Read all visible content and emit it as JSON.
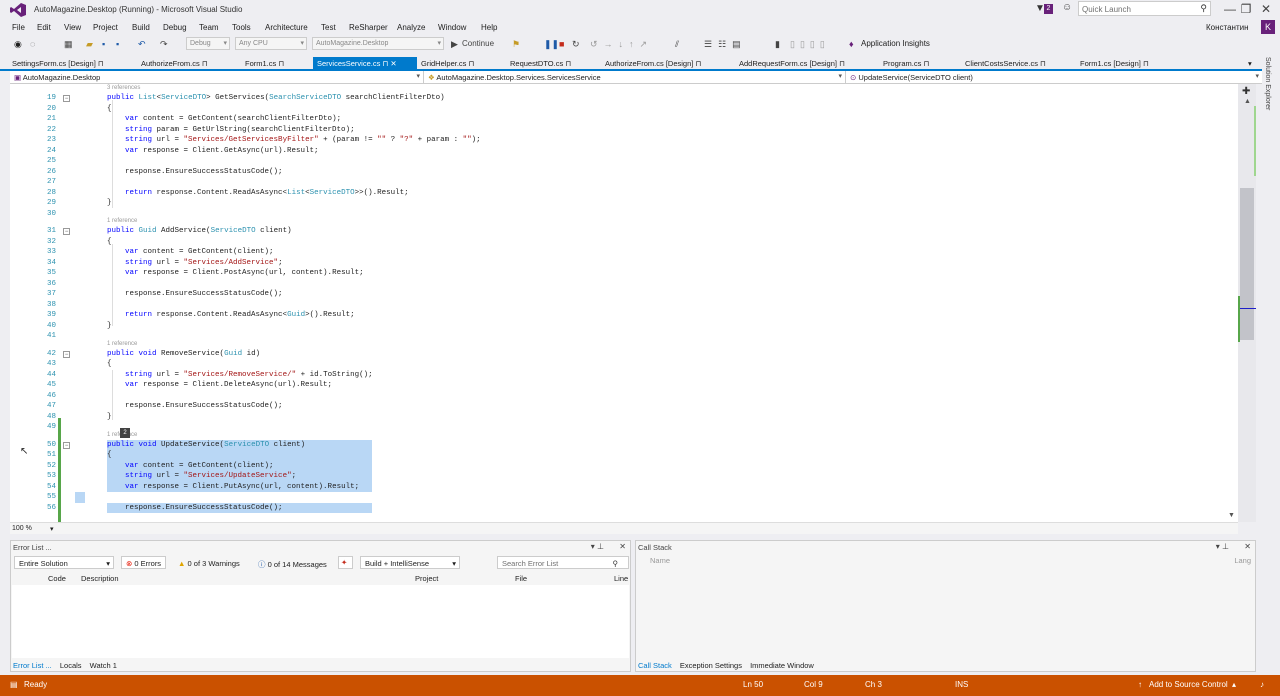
{
  "window": {
    "title": "AutoMagazine.Desktop (Running) - Microsoft Visual Studio",
    "quick_launch_placeholder": "Quick Launch",
    "notification_count": "2",
    "user": "Константин",
    "user_initial": "K",
    "controls": [
      "—",
      "❐",
      "✕"
    ]
  },
  "menu": [
    "File",
    "Edit",
    "View",
    "Project",
    "Build",
    "Debug",
    "Team",
    "Tools",
    "Architecture",
    "Test",
    "ReSharper",
    "Analyze",
    "Window",
    "Help"
  ],
  "toolbar": {
    "config": "Debug",
    "platform": "Any CPU",
    "startup": "AutoMagazine.Desktop",
    "continue": "Continue",
    "app_insights": "Application Insights"
  },
  "tabs": [
    {
      "label": "SettingsForm.cs [Design]",
      "active": false
    },
    {
      "label": "AuthorizeFrom.cs",
      "active": false
    },
    {
      "label": "Form1.cs",
      "active": false
    },
    {
      "label": "ServicesService.cs",
      "active": true
    },
    {
      "label": "GridHelper.cs",
      "active": false
    },
    {
      "label": "RequestDTO.cs",
      "active": false
    },
    {
      "label": "AuthorizeFrom.cs [Design]",
      "active": false
    },
    {
      "label": "AddRequestForm.cs [Design]",
      "active": false
    },
    {
      "label": "Program.cs",
      "active": false
    },
    {
      "label": "ClientCostsService.cs",
      "active": false
    },
    {
      "label": "Form1.cs [Design]",
      "active": false
    }
  ],
  "nav": {
    "project": "AutoMagazine.Desktop",
    "type": "AutoMagazine.Desktop.Services.ServicesService",
    "member": "UpdateService(ServiceDTO client)"
  },
  "code": [
    {
      "ref": "3 references"
    },
    {
      "n": "19",
      "t": "public List<ServiceDTO> GetServices(SearchServiceDTO searchClientFilterDto)"
    },
    {
      "n": "20",
      "t": "{"
    },
    {
      "n": "21",
      "t": "    var content = GetContent(searchClientFilterDto);"
    },
    {
      "n": "22",
      "t": "    string param = GetUrlString(searchClientFilterDto);"
    },
    {
      "n": "23",
      "t": "    string url = \"Services/GetServicesByFilter\" + (param != \"\" ? \"?\" + param : \"\");"
    },
    {
      "n": "24",
      "t": "    var response = Client.GetAsync(url).Result;"
    },
    {
      "n": "25",
      "t": ""
    },
    {
      "n": "26",
      "t": "    response.EnsureSuccessStatusCode();"
    },
    {
      "n": "27",
      "t": ""
    },
    {
      "n": "28",
      "t": "    return response.Content.ReadAsAsync<List<ServiceDTO>>().Result;"
    },
    {
      "n": "29",
      "t": "}"
    },
    {
      "n": "30",
      "t": ""
    },
    {
      "ref": "1 reference"
    },
    {
      "n": "31",
      "t": "public Guid AddService(ServiceDTO client)"
    },
    {
      "n": "32",
      "t": "{"
    },
    {
      "n": "33",
      "t": "    var content = GetContent(client);"
    },
    {
      "n": "34",
      "t": "    string url = \"Services/AddService\";"
    },
    {
      "n": "35",
      "t": "    var response = Client.PostAsync(url, content).Result;"
    },
    {
      "n": "36",
      "t": ""
    },
    {
      "n": "37",
      "t": "    response.EnsureSuccessStatusCode();"
    },
    {
      "n": "38",
      "t": ""
    },
    {
      "n": "39",
      "t": "    return response.Content.ReadAsAsync<Guid>().Result;"
    },
    {
      "n": "40",
      "t": "}"
    },
    {
      "n": "41",
      "t": ""
    },
    {
      "ref": "1 reference"
    },
    {
      "n": "42",
      "t": "public void RemoveService(Guid id)"
    },
    {
      "n": "43",
      "t": "{"
    },
    {
      "n": "44",
      "t": "    string url = \"Services/RemoveService/\" + id.ToString();"
    },
    {
      "n": "45",
      "t": "    var response = Client.DeleteAsync(url).Result;"
    },
    {
      "n": "46",
      "t": ""
    },
    {
      "n": "47",
      "t": "    response.EnsureSuccessStatusCode();"
    },
    {
      "n": "48",
      "t": "}"
    },
    {
      "n": "49",
      "t": ""
    },
    {
      "ref": "1 reference"
    },
    {
      "n": "50",
      "t": "public void UpdateService(ServiceDTO client)",
      "sel": true
    },
    {
      "n": "51",
      "t": "{",
      "sel": true
    },
    {
      "n": "52",
      "t": "    var content = GetContent(client);",
      "sel": true
    },
    {
      "n": "53",
      "t": "    string url = \"Services/UpdateService\";",
      "sel": true
    },
    {
      "n": "54",
      "t": "    var response = Client.PutAsync(url, content).Result;",
      "sel": true
    },
    {
      "n": "55",
      "t": "",
      "sel": true
    },
    {
      "n": "56",
      "t": "    response.EnsureSuccessStatusCode();",
      "sel": true
    }
  ],
  "quick_action_badge": "2",
  "zoom": "100 %",
  "error_list": {
    "title": "Error List ...",
    "scope": "Entire Solution",
    "errors": "0 Errors",
    "warnings": "0 of 3 Warnings",
    "messages": "0 of 14 Messages",
    "build": "Build + IntelliSense",
    "search_placeholder": "Search Error List",
    "columns": [
      "Code",
      "Description",
      "Project",
      "File",
      "Line"
    ],
    "tabs": [
      "Error List ...",
      "Locals",
      "Watch 1"
    ]
  },
  "call_stack": {
    "title": "Call Stack",
    "columns": [
      "Name",
      "Lang"
    ],
    "tabs": [
      "Call Stack",
      "Exception Settings",
      "Immediate Window"
    ]
  },
  "solution_explorer": "Solution Explorer",
  "status": {
    "ready": "Ready",
    "ln": "Ln 50",
    "col": "Col 9",
    "ch": "Ch 3",
    "ins": "INS",
    "source_control": "Add to Source Control"
  },
  "colors": {
    "accent": "#007acc",
    "status": "#ca5100",
    "selection": "#b9d7f5",
    "keyword": "#0000ff",
    "type": "#2b91af",
    "string": "#a31515"
  }
}
